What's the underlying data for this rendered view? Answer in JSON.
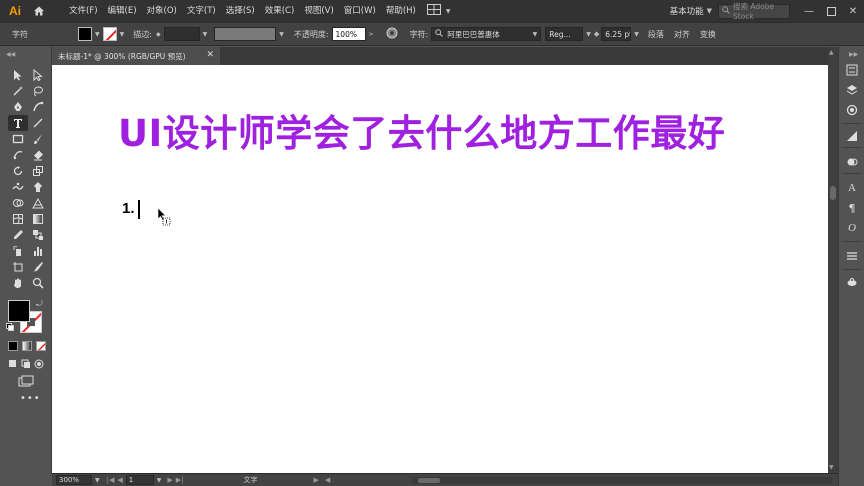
{
  "app": {
    "logo": "Ai",
    "menus": [
      "文件(F)",
      "编辑(E)",
      "对象(O)",
      "文字(T)",
      "选择(S)",
      "效果(C)",
      "视图(V)",
      "窗口(W)",
      "帮助(H)"
    ],
    "workspace": "基本功能",
    "search_placeholder": "搜索 Adobe Stock"
  },
  "control": {
    "mode_label": "字符",
    "stroke_label": "描边:",
    "opacity_label": "不透明度:",
    "opacity_value": "100%",
    "char_label": "字符:",
    "font_name": "阿里巴巴普惠体",
    "font_style": "Reg...",
    "font_size": "6.25 pt",
    "paragraph_label": "段落",
    "align_label": "对齐",
    "transform_label": "变换"
  },
  "document": {
    "tab_title": "未标题-1* @ 300% (RGB/GPU 预览)",
    "headline": "UI设计师学会了去什么地方工作最好",
    "body_text": "1."
  },
  "status": {
    "zoom": "300%",
    "page": "1",
    "tool_name": "文字"
  },
  "colors": {
    "headline": "#a020e0",
    "accent_logo": "#ff9a00",
    "stroke_none": "#ee2222"
  }
}
